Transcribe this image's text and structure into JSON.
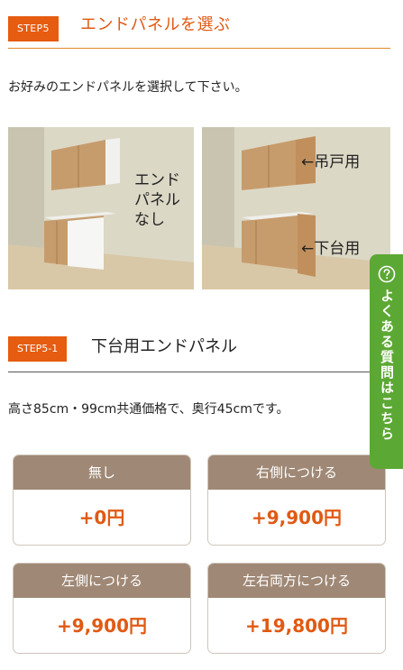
{
  "step": {
    "badge": "STEP5",
    "title": "エンドパネルを選ぶ",
    "intro": "お好みのエンドパネルを選択して下さい。"
  },
  "illustrations": {
    "left_caption": "エンド\nパネル\nなし",
    "right_upper_caption": "←吊戸用",
    "right_lower_caption": "←下台用"
  },
  "substep": {
    "badge": "STEP5-1",
    "title": "下台用エンドパネル",
    "description": "高さ85cm・99cm共通価格で、奥行45cmです。"
  },
  "options": [
    {
      "label": "無し",
      "price": "+0円"
    },
    {
      "label": "右側につける",
      "price": "+9,900円"
    },
    {
      "label": "左側につける",
      "price": "+9,900円"
    },
    {
      "label": "左右両方につける",
      "price": "+19,800円"
    }
  ],
  "faq": {
    "label": "よくある質問はこちら",
    "icon": "question-circle-icon"
  },
  "colors": {
    "accent_orange": "#e65c10",
    "card_header": "#9f8875",
    "faq_green": "#5ca834"
  }
}
